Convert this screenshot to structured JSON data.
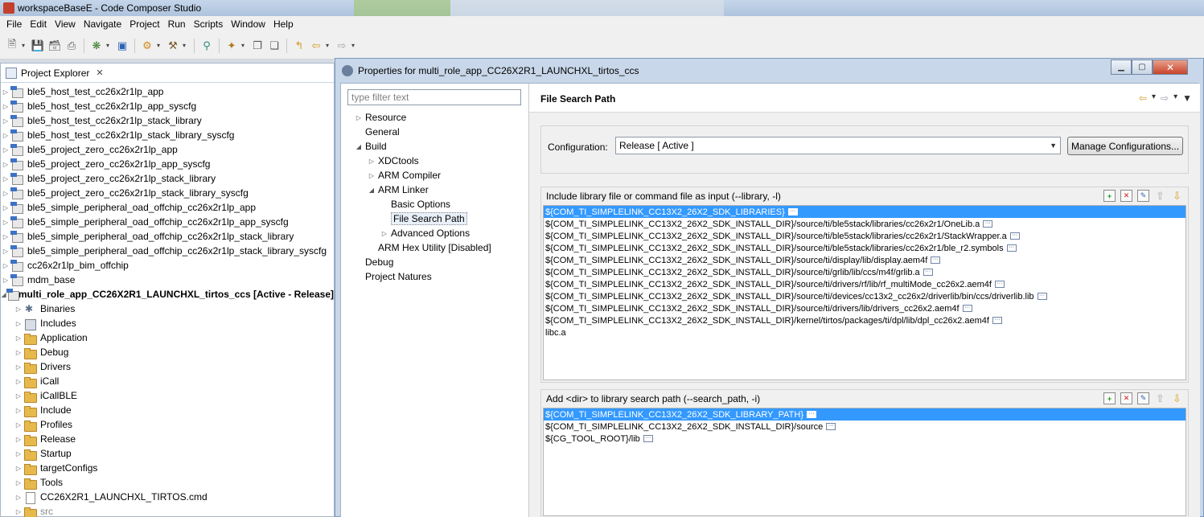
{
  "window": {
    "title": "workspaceBaseE - Code Composer Studio"
  },
  "menu": [
    "File",
    "Edit",
    "View",
    "Navigate",
    "Project",
    "Run",
    "Scripts",
    "Window",
    "Help"
  ],
  "explorer": {
    "tab_label": "Project Explorer",
    "projects": [
      "ble5_host_test_cc26x2r1lp_app",
      "ble5_host_test_cc26x2r1lp_app_syscfg",
      "ble5_host_test_cc26x2r1lp_stack_library",
      "ble5_host_test_cc26x2r1lp_stack_library_syscfg",
      "ble5_project_zero_cc26x2r1lp_app",
      "ble5_project_zero_cc26x2r1lp_app_syscfg",
      "ble5_project_zero_cc26x2r1lp_stack_library",
      "ble5_project_zero_cc26x2r1lp_stack_library_syscfg",
      "ble5_simple_peripheral_oad_offchip_cc26x2r1lp_app",
      "ble5_simple_peripheral_oad_offchip_cc26x2r1lp_app_syscfg",
      "ble5_simple_peripheral_oad_offchip_cc26x2r1lp_stack_library",
      "ble5_simple_peripheral_oad_offchip_cc26x2r1lp_stack_library_syscfg",
      "cc26x2r1lp_bim_offchip",
      "mdm_base"
    ],
    "active_project": "multi_role_app_CC26X2R1_LAUNCHXL_tirtos_ccs  [Active - Release]",
    "children": [
      {
        "label": "Binaries",
        "icon": "bin"
      },
      {
        "label": "Includes",
        "icon": "inc"
      },
      {
        "label": "Application",
        "icon": "folder"
      },
      {
        "label": "Debug",
        "icon": "folder"
      },
      {
        "label": "Drivers",
        "icon": "folder"
      },
      {
        "label": "iCall",
        "icon": "folder"
      },
      {
        "label": "iCallBLE",
        "icon": "folder"
      },
      {
        "label": "Include",
        "icon": "folder"
      },
      {
        "label": "Profiles",
        "icon": "folder"
      },
      {
        "label": "Release",
        "icon": "folder"
      },
      {
        "label": "Startup",
        "icon": "folder"
      },
      {
        "label": "targetConfigs",
        "icon": "folder"
      },
      {
        "label": "Tools",
        "icon": "folder"
      },
      {
        "label": "CC26X2R1_LAUNCHXL_TIRTOS.cmd",
        "icon": "file"
      },
      {
        "label": "src",
        "icon": "folder"
      }
    ]
  },
  "dialog": {
    "title": "Properties for multi_role_app_CC26X2R1_LAUNCHXL_tirtos_ccs",
    "filter_placeholder": "type filter text",
    "nav": [
      {
        "label": "Resource",
        "indent": 0,
        "tw": "▷"
      },
      {
        "label": "General",
        "indent": 0,
        "tw": ""
      },
      {
        "label": "Build",
        "indent": 0,
        "tw": "◢"
      },
      {
        "label": "XDCtools",
        "indent": 1,
        "tw": "▷"
      },
      {
        "label": "ARM Compiler",
        "indent": 1,
        "tw": "▷"
      },
      {
        "label": "ARM Linker",
        "indent": 1,
        "tw": "◢"
      },
      {
        "label": "Basic Options",
        "indent": 2,
        "tw": ""
      },
      {
        "label": "File Search Path",
        "indent": 2,
        "tw": "",
        "selected": true
      },
      {
        "label": "Advanced Options",
        "indent": 2,
        "tw": "▷"
      },
      {
        "label": "ARM Hex Utility  [Disabled]",
        "indent": 1,
        "tw": ""
      },
      {
        "label": "Debug",
        "indent": 0,
        "tw": ""
      },
      {
        "label": "Project Natures",
        "indent": 0,
        "tw": ""
      }
    ],
    "page_title": "File Search Path",
    "configuration_label": "Configuration:",
    "configuration_value": "Release  [ Active ]",
    "manage_button": "Manage Configurations...",
    "library_group": {
      "title": "Include library file or command file as input (--library, -l)",
      "items": [
        {
          "text": "${COM_TI_SIMPLELINK_CC13X2_26X2_SDK_LIBRARIES}",
          "dots": true,
          "selected": true
        },
        {
          "text": "${COM_TI_SIMPLELINK_CC13X2_26X2_SDK_INSTALL_DIR}/source/ti/ble5stack/libraries/cc26x2r1/OneLib.a",
          "dots": true
        },
        {
          "text": "${COM_TI_SIMPLELINK_CC13X2_26X2_SDK_INSTALL_DIR}/source/ti/ble5stack/libraries/cc26x2r1/StackWrapper.a",
          "dots": true
        },
        {
          "text": "${COM_TI_SIMPLELINK_CC13X2_26X2_SDK_INSTALL_DIR}/source/ti/ble5stack/libraries/cc26x2r1/ble_r2.symbols",
          "dots": true
        },
        {
          "text": "${COM_TI_SIMPLELINK_CC13X2_26X2_SDK_INSTALL_DIR}/source/ti/display/lib/display.aem4f",
          "dots": true
        },
        {
          "text": "${COM_TI_SIMPLELINK_CC13X2_26X2_SDK_INSTALL_DIR}/source/ti/grlib/lib/ccs/m4f/grlib.a",
          "dots": true
        },
        {
          "text": "${COM_TI_SIMPLELINK_CC13X2_26X2_SDK_INSTALL_DIR}/source/ti/drivers/rf/lib/rf_multiMode_cc26x2.aem4f",
          "dots": true
        },
        {
          "text": "${COM_TI_SIMPLELINK_CC13X2_26X2_SDK_INSTALL_DIR}/source/ti/devices/cc13x2_cc26x2/driverlib/bin/ccs/driverlib.lib",
          "dots": true
        },
        {
          "text": "${COM_TI_SIMPLELINK_CC13X2_26X2_SDK_INSTALL_DIR}/source/ti/drivers/lib/drivers_cc26x2.aem4f",
          "dots": true
        },
        {
          "text": "${COM_TI_SIMPLELINK_CC13X2_26X2_SDK_INSTALL_DIR}/kernel/tirtos/packages/ti/dpl/lib/dpl_cc26x2.aem4f",
          "dots": true
        },
        {
          "text": "libc.a",
          "dots": false
        }
      ]
    },
    "search_group": {
      "title": "Add <dir> to library search path (--search_path, -i)",
      "items": [
        {
          "text": "${COM_TI_SIMPLELINK_CC13X2_26X2_SDK_LIBRARY_PATH}",
          "dots": true,
          "selected": true
        },
        {
          "text": "${COM_TI_SIMPLELINK_CC13X2_26X2_SDK_INSTALL_DIR}/source",
          "dots": true
        },
        {
          "text": "${CG_TOOL_ROOT}/lib",
          "dots": true
        }
      ]
    }
  }
}
